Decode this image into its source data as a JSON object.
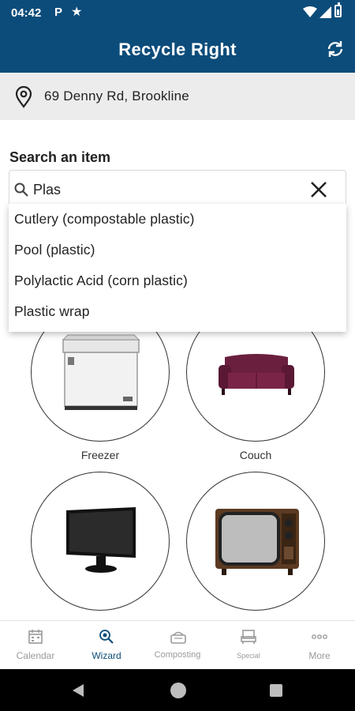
{
  "status_bar": {
    "time": "04:42",
    "notification_icons": [
      "parking-icon",
      "star-icon"
    ],
    "system_icons": [
      "wifi-icon",
      "signal-icon",
      "battery-icon"
    ]
  },
  "app_bar": {
    "title": "Recycle Right",
    "action_icon": "refresh-icon"
  },
  "address": {
    "icon": "location-pin-icon",
    "text": "69 Denny Rd, Brookline"
  },
  "search": {
    "label": "Search an item",
    "value": "Plas",
    "left_icon": "search-icon",
    "right_icon": "close-icon",
    "suggestions": [
      "Cutlery (compostable plastic)",
      "Pool (plastic)",
      "Polylactic Acid (corn plastic)",
      "Plastic wrap"
    ]
  },
  "items": [
    {
      "label": "Freezer",
      "icon": "freezer-image"
    },
    {
      "label": "Couch",
      "icon": "couch-image"
    },
    {
      "label": "",
      "icon": "monitor-image"
    },
    {
      "label": "",
      "icon": "tv-image"
    }
  ],
  "bottom_nav": [
    {
      "label": "Calendar",
      "icon": "calendar-icon",
      "active": false
    },
    {
      "label": "Wizard",
      "icon": "wizard-search-icon",
      "active": true
    },
    {
      "label": "Composting",
      "icon": "composting-icon",
      "active": false
    },
    {
      "label": "Special",
      "icon": "special-icon",
      "active": false
    },
    {
      "label": "More",
      "icon": "more-icon",
      "active": false
    }
  ],
  "colors": {
    "primary": "#0c4c7a",
    "address_bg": "#ececec",
    "nav_inactive": "#9a9a9a",
    "couch": "#6b1f3f"
  }
}
